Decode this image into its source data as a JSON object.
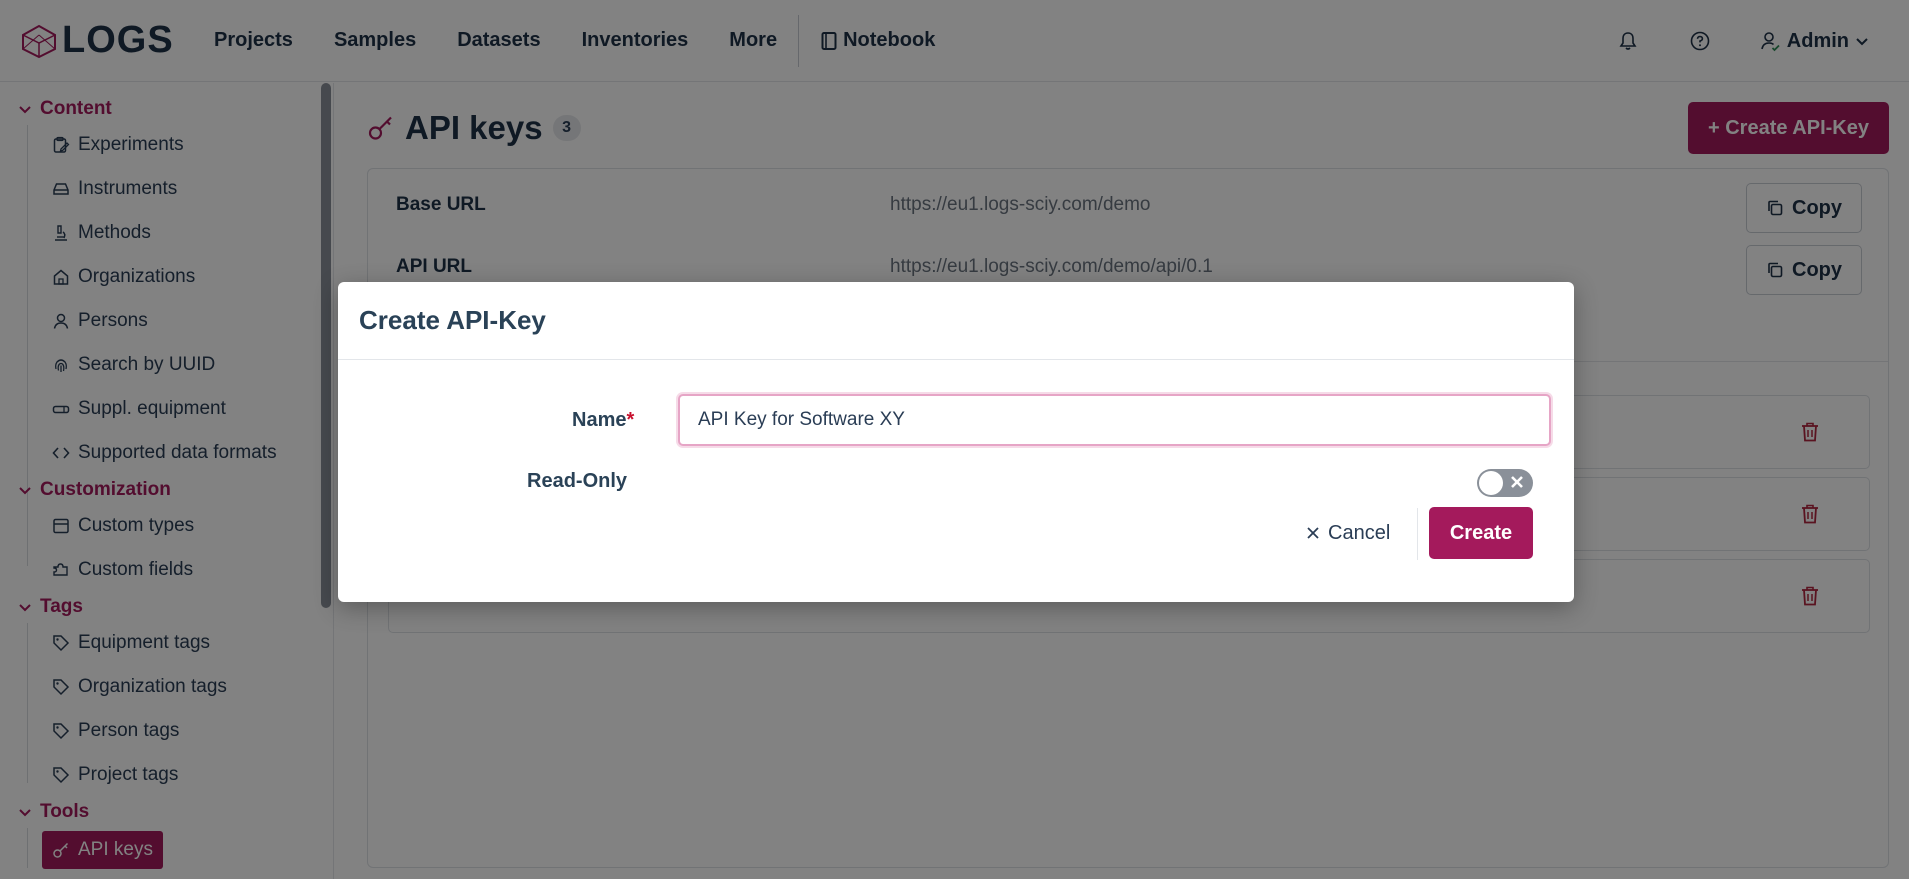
{
  "app": {
    "logo_text": "LOGS"
  },
  "nav": {
    "items": [
      "Projects",
      "Samples",
      "Datasets",
      "Inventories",
      "More"
    ],
    "notebook": "Notebook",
    "user": "Admin"
  },
  "sidebar": {
    "groups": [
      {
        "label": "Content",
        "items": [
          "Experiments",
          "Instruments",
          "Methods",
          "Organizations",
          "Persons",
          "Search by UUID",
          "Suppl. equipment",
          "Supported data formats"
        ]
      },
      {
        "label": "Customization",
        "items": [
          "Custom types",
          "Custom fields"
        ]
      },
      {
        "label": "Tags",
        "items": [
          "Equipment tags",
          "Organization tags",
          "Person tags",
          "Project tags"
        ]
      },
      {
        "label": "Tools",
        "items": [
          "API keys"
        ]
      }
    ],
    "active_item": "API keys"
  },
  "main": {
    "title": "API keys",
    "count": "3",
    "create_button": "+ Create API-Key",
    "base_url_label": "Base URL",
    "base_url_value": "https://eu1.logs-sciy.com/demo",
    "api_url_label": "API URL",
    "api_url_value": "https://eu1.logs-sciy.com/demo/api/0.1",
    "copy_label": "Copy"
  },
  "modal": {
    "title": "Create API-Key",
    "name_label": "Name",
    "required_mark": "*",
    "name_value": "API Key for Software XY",
    "readonly_label": "Read-Only",
    "readonly_enabled": false,
    "cancel_label": "Cancel",
    "create_label": "Create"
  },
  "colors": {
    "accent": "#a41a5c",
    "text": "#1f3148",
    "overlay": "rgba(0,0,0,0.49)"
  }
}
